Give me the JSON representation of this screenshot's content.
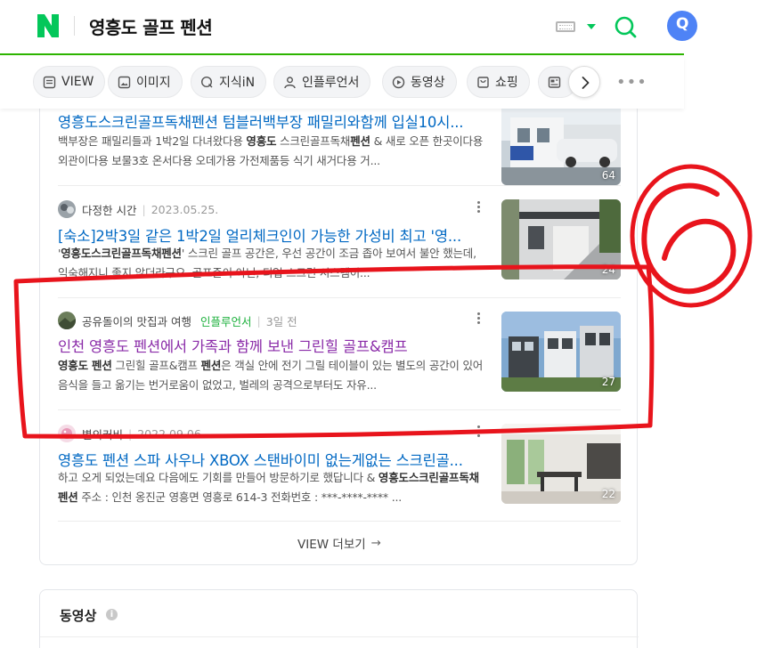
{
  "header": {
    "logo": "N",
    "query": "영흥도 골프 펜션",
    "brand_color": "#03c75a",
    "icons": [
      "keyboard-icon",
      "caret-down-icon",
      "search-icon",
      "user-avatar"
    ]
  },
  "tabs": [
    {
      "label": "VIEW",
      "icon": "view-icon"
    },
    {
      "label": "이미지",
      "icon": "image-icon"
    },
    {
      "label": "지식iN",
      "icon": "q-icon"
    },
    {
      "label": "인플루언서",
      "icon": "person-icon"
    },
    {
      "label": "동영상",
      "icon": "play-icon"
    },
    {
      "label": "쇼핑",
      "icon": "bag-icon"
    },
    {
      "label": "",
      "icon": "news-icon"
    }
  ],
  "results": [
    {
      "author": "",
      "badge": "",
      "date": "",
      "title": "영흥도스크린골프독채펜션 텀블러백부장 패밀리와함께 입실10시...",
      "desc": [
        "백부장은 패밀리들과 1박2일 다녀왔다용 ",
        "영흥도",
        " 스크린골프독채",
        "펜션",
        " & 새로 오픈 한곳이다용 외관이다용 보물3호 온서다용 오데가용 가전제품등 식기 새거다용 거..."
      ],
      "count": "64"
    },
    {
      "author": "다정한 시간",
      "badge": "",
      "date": "2023.05.25.",
      "title": "[숙소]2박3일 같은 1박2일 얼리체크인이 가능한 가성비 최고 '영...",
      "desc": [
        "'",
        "영흥도스크린골프독채펜션",
        "' 스크린 골프 공간은, 우선 공간이 조금 좁아 보여서 불안 했는데, 익숙해지니 좋지 않더라구요. 골프존이 아닌, 티업 스크린 시스템이..."
      ],
      "count": "24"
    },
    {
      "author": "공유돌이의 맛집과 여행",
      "badge": "인플루언서",
      "date": "3일 전",
      "title": "인천 영흥도 펜션에서 가족과 함께 보낸 그린힐 골프&캠프",
      "desc": [
        "",
        "영흥도 펜션",
        " 그린힐 골프&캠프 ",
        "펜션",
        "은 객실 안에 전기 그릴 테이블이 있는 별도의 공간이 있어 음식을 들고 옮기는 번거로움이 없었고, 벌레의 공격으로부터도 자유..."
      ],
      "count": "27"
    },
    {
      "author": "별의커비",
      "badge": "",
      "date": "2022.09.06.",
      "title": "영흥도 펜션 스파 사우나 XBOX 스탠바이미 없는게없는 스크린골...",
      "desc": [
        "하고 오게 되었는데요 다음에도 기회를 만들어 방문하기로 했답니다 & ",
        "영흥도스크린골프독채펜션",
        " 주소 : 인천 옹진군 영흥면 영흥로 614-3 전화번호 : ***-****-**** ..."
      ],
      "count": "22"
    }
  ],
  "more": {
    "label": "VIEW 더보기",
    "arrow": "→"
  },
  "video_section": {
    "title": "동영상",
    "info": "i"
  },
  "annotation": {
    "label": "6",
    "color": "#e8141c"
  }
}
